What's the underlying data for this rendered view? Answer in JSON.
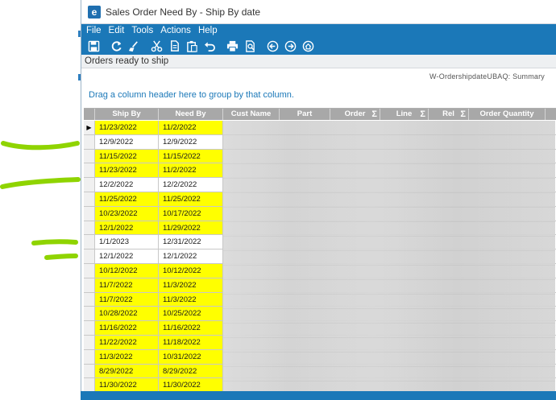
{
  "window": {
    "app_icon_letter": "e",
    "title": "Sales Order Need By - Ship By date"
  },
  "menu": [
    "File",
    "Edit",
    "Tools",
    "Actions",
    "Help"
  ],
  "toolbar_icons": [
    "save-icon",
    "refresh-icon",
    "clear-icon",
    "cut-icon",
    "copy-icon",
    "paste-icon",
    "undo-icon",
    "print-icon",
    "print-preview-icon",
    "back-icon",
    "forward-icon",
    "home-icon"
  ],
  "panel": {
    "header": "Orders ready to ship",
    "query_title": "W-OrdershipdateUBAQ: Summary",
    "group_hint": "Drag a column header here to group by that column."
  },
  "grid": {
    "columns": [
      "Ship By",
      "Need By",
      "Cust Name",
      "Part",
      "Order",
      "Line",
      "Rel",
      "Order Quantity"
    ],
    "rows": [
      {
        "ship_by": "11/23/2022",
        "need_by": "11/2/2022",
        "highlight": true,
        "current": true
      },
      {
        "ship_by": "12/9/2022",
        "need_by": "12/9/2022",
        "highlight": false
      },
      {
        "ship_by": "11/15/2022",
        "need_by": "11/15/2022",
        "highlight": true
      },
      {
        "ship_by": "11/23/2022",
        "need_by": "11/2/2022",
        "highlight": true
      },
      {
        "ship_by": "12/2/2022",
        "need_by": "12/2/2022",
        "highlight": false
      },
      {
        "ship_by": "11/25/2022",
        "need_by": "11/25/2022",
        "highlight": true
      },
      {
        "ship_by": "10/23/2022",
        "need_by": "10/17/2022",
        "highlight": true
      },
      {
        "ship_by": "12/1/2022",
        "need_by": "11/29/2022",
        "highlight": true
      },
      {
        "ship_by": "1/1/2023",
        "need_by": "12/31/2022",
        "highlight": false
      },
      {
        "ship_by": "12/1/2022",
        "need_by": "12/1/2022",
        "highlight": false
      },
      {
        "ship_by": "10/12/2022",
        "need_by": "10/12/2022",
        "highlight": true
      },
      {
        "ship_by": "11/7/2022",
        "need_by": "11/3/2022",
        "highlight": true
      },
      {
        "ship_by": "11/7/2022",
        "need_by": "11/3/2022",
        "highlight": true
      },
      {
        "ship_by": "10/28/2022",
        "need_by": "10/25/2022",
        "highlight": true
      },
      {
        "ship_by": "11/16/2022",
        "need_by": "11/16/2022",
        "highlight": true
      },
      {
        "ship_by": "11/22/2022",
        "need_by": "11/18/2022",
        "highlight": true
      },
      {
        "ship_by": "11/3/2022",
        "need_by": "10/31/2022",
        "highlight": true
      },
      {
        "ship_by": "8/29/2022",
        "need_by": "8/29/2022",
        "highlight": true
      },
      {
        "ship_by": "11/30/2022",
        "need_by": "11/30/2022",
        "highlight": true
      }
    ]
  },
  "colors": {
    "accent": "#1b78b8",
    "highlight": "#ffff00",
    "header_gray": "#a8a8a8",
    "annotation_green": "#8fd400"
  }
}
